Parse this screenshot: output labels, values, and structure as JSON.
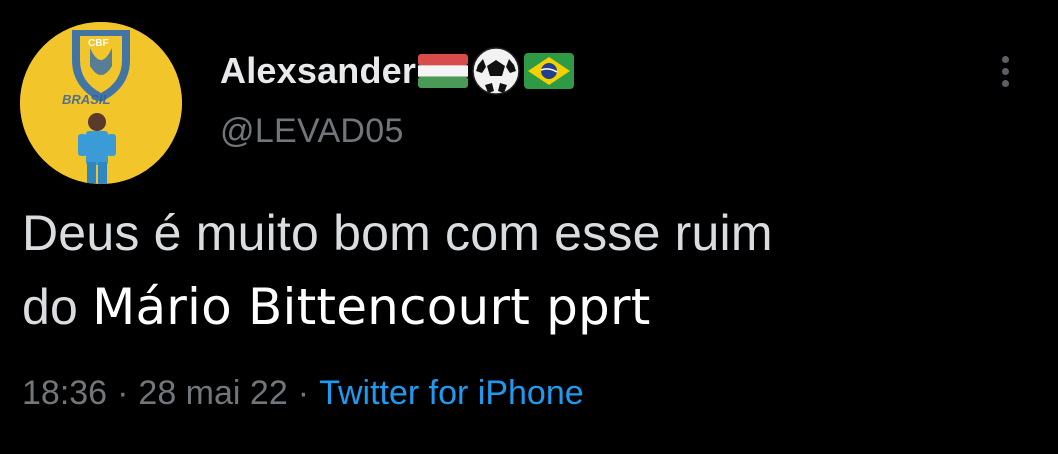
{
  "tweet": {
    "display_name": "Alexsander",
    "handle": "@LEVAD05",
    "text_part1": "Deus é muito bom com esse ruim",
    "text_part2": "do",
    "overlay_text": "Mário Bittencourt pprt",
    "time": "18:36",
    "date": "28 mai 22",
    "separator": "·",
    "source": "Twitter for iPhone"
  },
  "avatar": {
    "badge_text": "CBF",
    "banner_text": "BRASIL"
  },
  "emojis": [
    "hungary-flag-icon",
    "soccer-ball-icon",
    "brazil-flag-icon"
  ],
  "colors": {
    "background": "#000000",
    "name": "#e7e9ea",
    "secondary": "#71767b",
    "link": "#1d9bf0",
    "avatar_bg": "#f3c72a"
  }
}
